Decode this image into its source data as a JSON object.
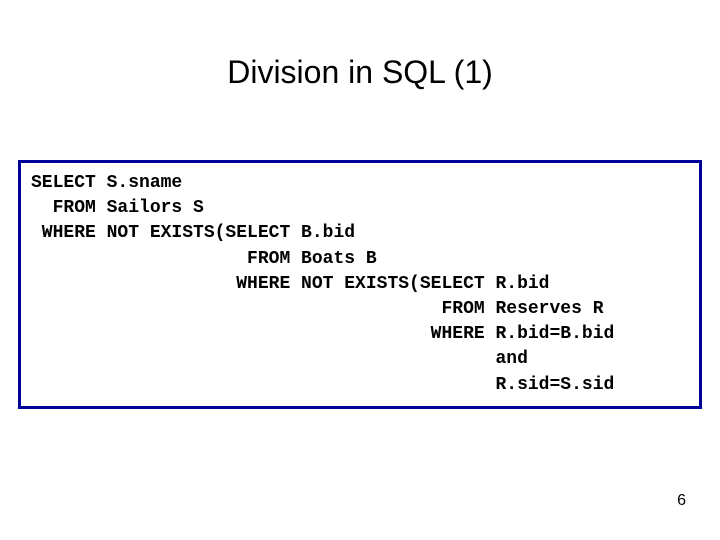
{
  "title": "Division in SQL (1)",
  "code": "SELECT S.sname\n  FROM Sailors S\n WHERE NOT EXISTS(SELECT B.bid\n                    FROM Boats B\n                   WHERE NOT EXISTS(SELECT R.bid\n                                      FROM Reserves R\n                                     WHERE R.bid=B.bid\n                                           and\n                                           R.sid=S.sid",
  "page_number": "6"
}
